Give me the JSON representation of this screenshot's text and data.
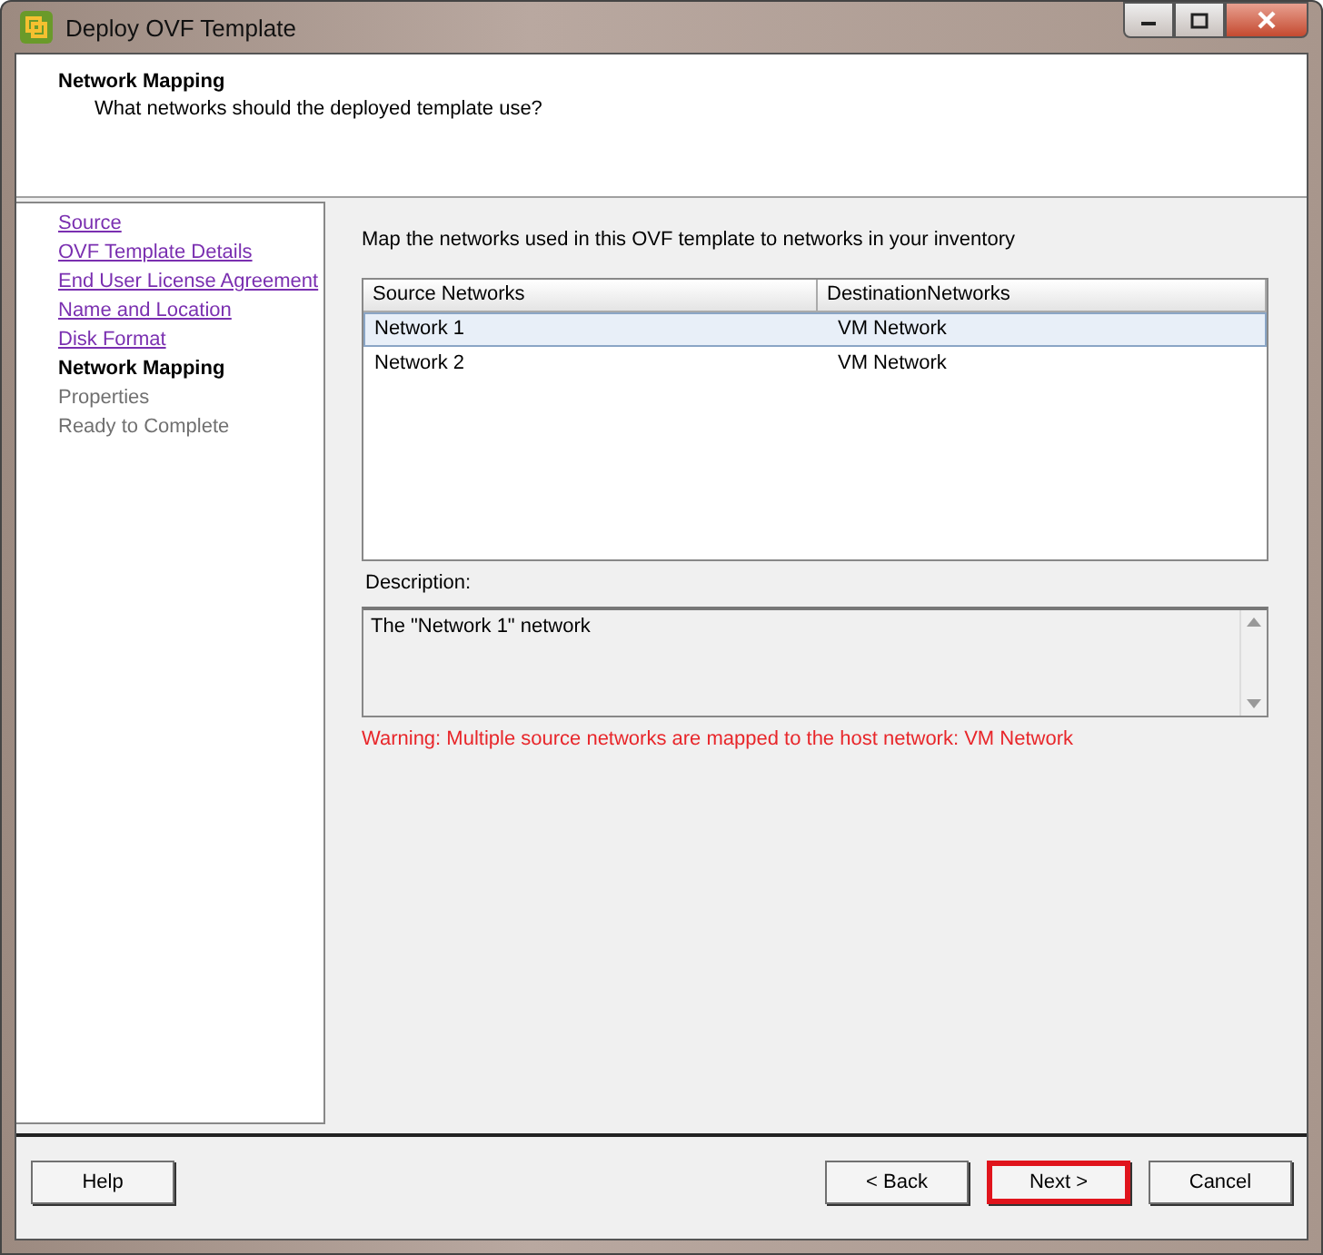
{
  "window": {
    "title": "Deploy OVF Template"
  },
  "header": {
    "title": "Network Mapping",
    "subtitle": "What networks should the deployed template use?"
  },
  "steps": [
    {
      "label": "Source",
      "visited": true,
      "current": false
    },
    {
      "label": "OVF Template Details",
      "visited": true,
      "current": false
    },
    {
      "label": "End User License Agreement",
      "visited": true,
      "current": false
    },
    {
      "label": "Name and Location",
      "visited": true,
      "current": false
    },
    {
      "label": "Disk Format",
      "visited": true,
      "current": false
    },
    {
      "label": "Network Mapping",
      "visited": false,
      "current": true
    },
    {
      "label": "Properties",
      "visited": false,
      "current": false
    },
    {
      "label": "Ready to Complete",
      "visited": false,
      "current": false
    }
  ],
  "instruction": "Map the networks used in this OVF template to networks in your inventory",
  "table": {
    "columns": [
      "Source Networks",
      "DestinationNetworks"
    ],
    "rows": [
      {
        "cells": [
          "Network 1",
          "VM Network"
        ],
        "selected": true
      },
      {
        "cells": [
          "Network 2",
          "VM Network"
        ],
        "selected": false
      }
    ]
  },
  "description": {
    "label": "Description:",
    "text": "The \"Network 1\" network"
  },
  "warning": "Warning: Multiple source networks are mapped to the host network: VM Network",
  "buttons": [
    {
      "label": "Help",
      "kind": "help",
      "highlighted": false
    },
    {
      "label": "< Back",
      "kind": "nav",
      "highlighted": false
    },
    {
      "label": "Next >",
      "kind": "nav",
      "highlighted": true
    },
    {
      "label": "Cancel",
      "kind": "nav",
      "highlighted": false
    }
  ]
}
